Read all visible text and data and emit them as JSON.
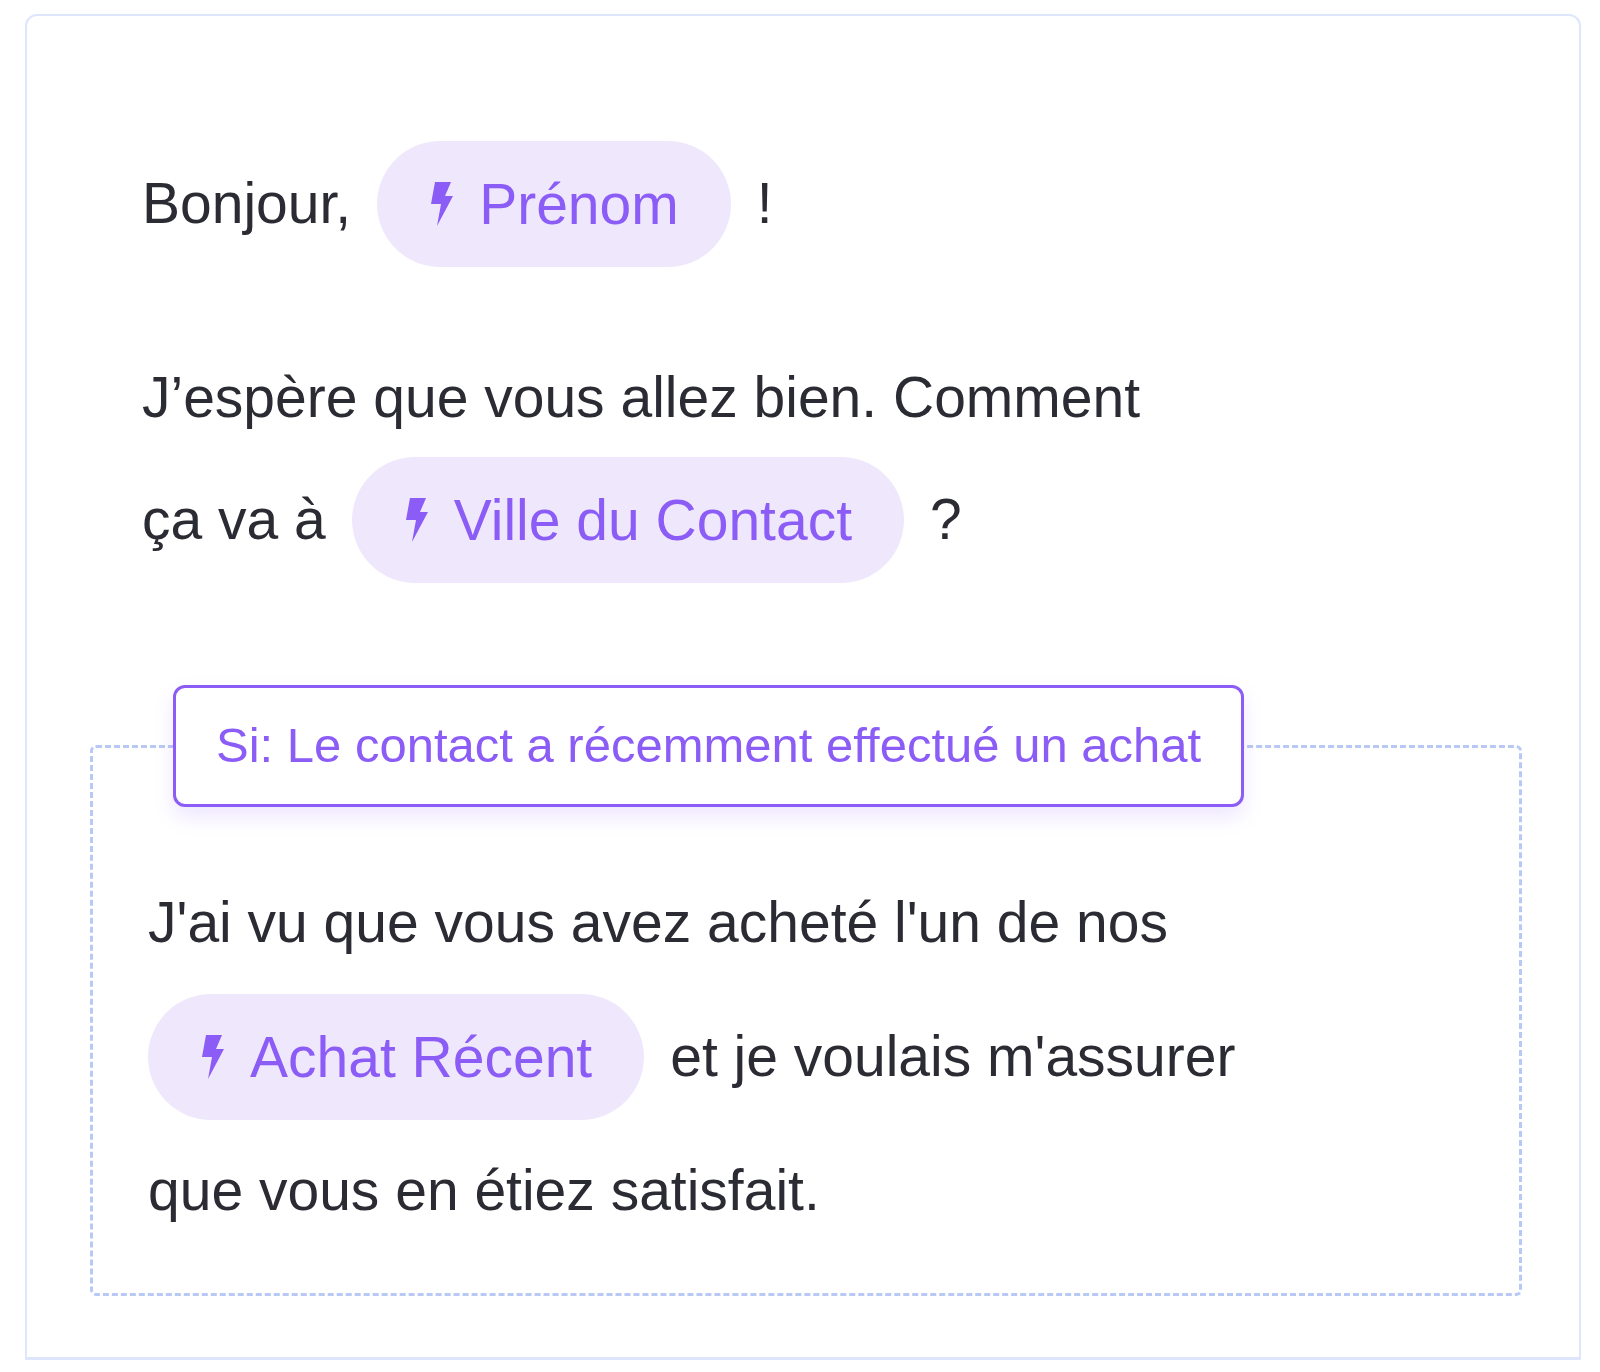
{
  "paragraphs": [
    {
      "lines": [
        [
          {
            "kind": "text",
            "text": "Bonjour,"
          },
          {
            "kind": "variable",
            "text": "Prénom"
          },
          {
            "kind": "text",
            "text": "!"
          }
        ]
      ]
    },
    {
      "lines": [
        [
          {
            "kind": "text",
            "text": "J’espère que vous allez bien. Comment"
          }
        ],
        [
          {
            "kind": "text",
            "text": "ça va à"
          },
          {
            "kind": "variable",
            "text": "Ville du Contact"
          },
          {
            "kind": "text",
            "text": "?"
          }
        ]
      ]
    }
  ],
  "condition": {
    "label": "Si: Le contact a récemment effectué un achat",
    "lines": [
      [
        {
          "kind": "text",
          "text": "J'ai vu que vous avez acheté l'un de nos"
        }
      ],
      [
        {
          "kind": "variable",
          "text": "Achat Récent"
        },
        {
          "kind": "text",
          "text": "et je voulais m'assurer"
        }
      ],
      [
        {
          "kind": "text",
          "text": "que vous en étiez satisfait."
        }
      ]
    ]
  }
}
